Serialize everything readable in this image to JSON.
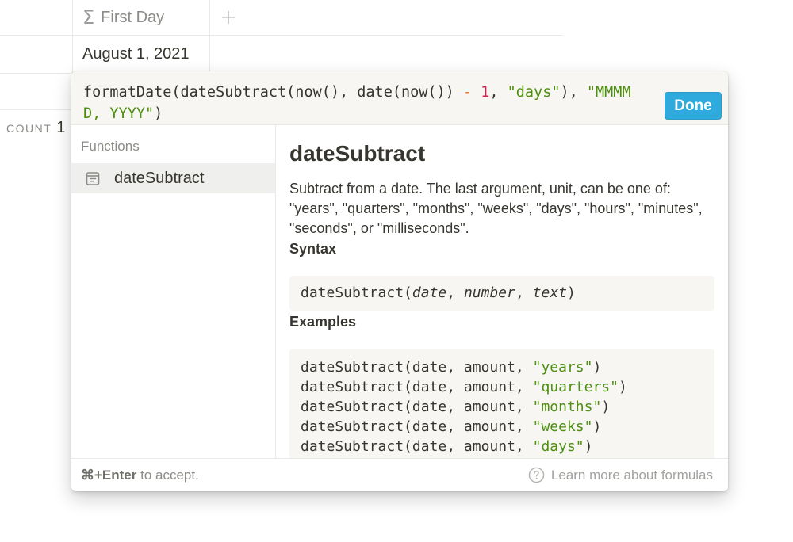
{
  "table": {
    "column_name": "First Day",
    "column_icon": "sigma-icon",
    "add_column_symbol": "+",
    "cell_value": "August 1, 2021",
    "count_label": "COUNT",
    "count_value": "1"
  },
  "formula_editor": {
    "tokens": {
      "t1": "formatDate(dateSubtract(now(), date(now()) ",
      "op": "-",
      "sp1": " ",
      "num": "1",
      "t2": ", ",
      "str1": "\"days\"",
      "t3": "), ",
      "str2": "\"MMMM D, YYYY\"",
      "t4": ")"
    },
    "done_label": "Done"
  },
  "sidebar": {
    "title": "Functions",
    "items": [
      {
        "label": "dateSubtract",
        "icon": "calendar-icon"
      }
    ]
  },
  "docs": {
    "title": "dateSubtract",
    "description": "Subtract from a date. The last argument, unit, can be one of: \"years\", \"quarters\", \"months\", \"weeks\", \"days\", \"hours\", \"minutes\", \"seconds\", or \"milliseconds\".",
    "syntax_heading": "Syntax",
    "syntax": {
      "fn": "dateSubtract(",
      "arg1": "date",
      "sep1": ", ",
      "arg2": "number",
      "sep2": ", ",
      "arg3": "text",
      "close": ")"
    },
    "examples_heading": "Examples",
    "examples": [
      {
        "prefix": "dateSubtract(date, amount, ",
        "unit": "\"years\"",
        "suffix": ")"
      },
      {
        "prefix": "dateSubtract(date, amount, ",
        "unit": "\"quarters\"",
        "suffix": ")"
      },
      {
        "prefix": "dateSubtract(date, amount, ",
        "unit": "\"months\"",
        "suffix": ")"
      },
      {
        "prefix": "dateSubtract(date, amount, ",
        "unit": "\"weeks\"",
        "suffix": ")"
      },
      {
        "prefix": "dateSubtract(date, amount, ",
        "unit": "\"days\"",
        "suffix": ")"
      }
    ]
  },
  "footer": {
    "shortcut": "⌘+Enter",
    "hint_rest": " to accept.",
    "learn_more": "Learn more about formulas"
  }
}
